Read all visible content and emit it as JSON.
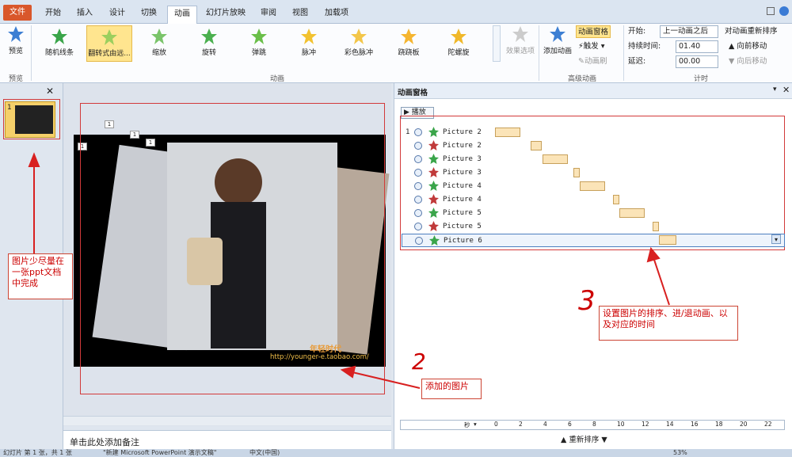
{
  "tabs": [
    "文件",
    "开始",
    "插入",
    "设计",
    "切换",
    "动画",
    "幻灯片放映",
    "审阅",
    "视图",
    "加载项"
  ],
  "ribbon": {
    "preview": {
      "label": "预览",
      "group": "预览"
    },
    "effects": [
      "随机线条",
      "翻转式由远...",
      "缩放",
      "旋转",
      "弹跳",
      "脉冲",
      "彩色脉冲",
      "跷跷板",
      "陀螺旋"
    ],
    "effect_options": "效果选项",
    "animation_group": "动画",
    "add_animation": "添加动画",
    "anim_pane_btn": "动画窗格",
    "trigger": "触发",
    "anim_painter": "动画刷",
    "advanced_group": "高级动画",
    "start_label": "开始:",
    "start_value": "上一动画之后",
    "duration_label": "持续时间:",
    "duration_value": "01.40",
    "delay_label": "延迟:",
    "delay_value": "00.00",
    "timing_group": "计时",
    "reorder_title": "对动画重新排序",
    "move_earlier": "向前移动",
    "move_later": "向后移动"
  },
  "thumb_number": "1",
  "anim_pane": {
    "title": "动画窗格",
    "play": "播放",
    "items": [
      {
        "num": "1",
        "name": "Picture 2"
      },
      {
        "num": "",
        "name": "Picture 2"
      },
      {
        "num": "",
        "name": "Picture 3"
      },
      {
        "num": "",
        "name": "Picture 3"
      },
      {
        "num": "",
        "name": "Picture 4"
      },
      {
        "num": "",
        "name": "Picture 4"
      },
      {
        "num": "",
        "name": "Picture 5"
      },
      {
        "num": "",
        "name": "Picture 5"
      },
      {
        "num": "",
        "name": "Picture 6"
      }
    ],
    "seconds_label": "秒",
    "ticks": [
      "0",
      "2",
      "4",
      "6",
      "8",
      "10",
      "12",
      "14",
      "16",
      "18",
      "20",
      "22"
    ],
    "reorder_label": "重新排序"
  },
  "slide": {
    "watermark_title": "年轻时代",
    "watermark_url": "http://younger-e.taobao.com/",
    "tags": [
      "1",
      "1",
      "1",
      "1"
    ]
  },
  "notes_placeholder": "单击此处添加备注",
  "annotations": {
    "note1": "图片少尽量在一张ppt文档中完成",
    "note2": "添加的图片",
    "note3": "设置图片的排序、进/退动画、以及对应的时间",
    "num2": "2",
    "num3": "3"
  },
  "status": {
    "slide_info": "幻灯片 第 1 张，共 1 张",
    "theme": "\"新建 Microsoft PowerPoint 演示文稿\"",
    "lang": "中文(中国)",
    "zoom": "53%"
  },
  "colors": {
    "accent": "#d9572b",
    "note": "#d23a3a",
    "bar": "#fbe4b8"
  }
}
